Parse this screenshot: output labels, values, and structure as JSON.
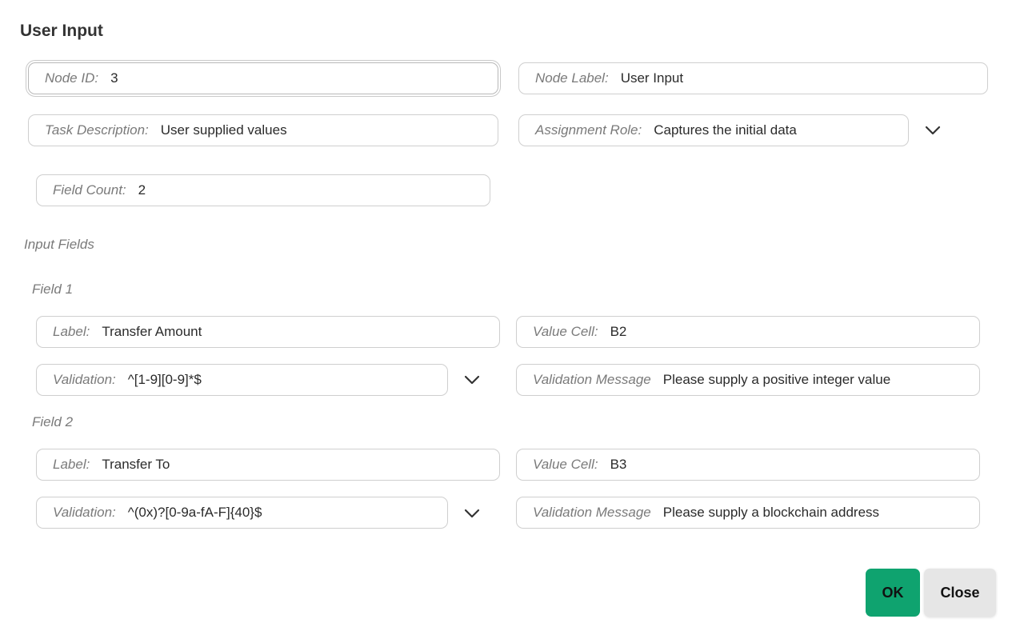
{
  "dialog": {
    "title": "User Input"
  },
  "node": {
    "id_label": "Node ID:",
    "id_value": "3",
    "node_label_label": "Node Label:",
    "node_label_value": "User Input",
    "task_label": "Task Description:",
    "task_value": "User supplied values",
    "role_label": "Assignment Role:",
    "role_value": "Captures the initial data",
    "count_label": "Field Count:",
    "count_value": "2"
  },
  "input_fields": {
    "heading": "Input Fields",
    "fields": [
      {
        "heading": "Field 1",
        "label_label": "Label:",
        "label_value": "Transfer Amount",
        "cell_label": "Value Cell:",
        "cell_value": "B2",
        "validation_label": "Validation:",
        "validation_value": "^[1-9][0-9]*$",
        "message_label": "Validation Message",
        "message_value": "Please supply a positive integer value"
      },
      {
        "heading": "Field 2",
        "label_label": "Label:",
        "label_value": "Transfer To",
        "cell_label": "Value Cell:",
        "cell_value": "B3",
        "validation_label": "Validation:",
        "validation_value": "^(0x)?[0-9a-fA-F]{40}$",
        "message_label": "Validation Message",
        "message_value": "Please supply a blockchain address"
      }
    ]
  },
  "buttons": {
    "ok": "OK",
    "close": "Close"
  },
  "colors": {
    "ok_button": "#0fa36f",
    "close_button": "#e6e6e6",
    "label_text": "#7a7a7a",
    "border": "#cfcfcf"
  },
  "icons": {
    "dropdown": "chevron-down-icon"
  }
}
